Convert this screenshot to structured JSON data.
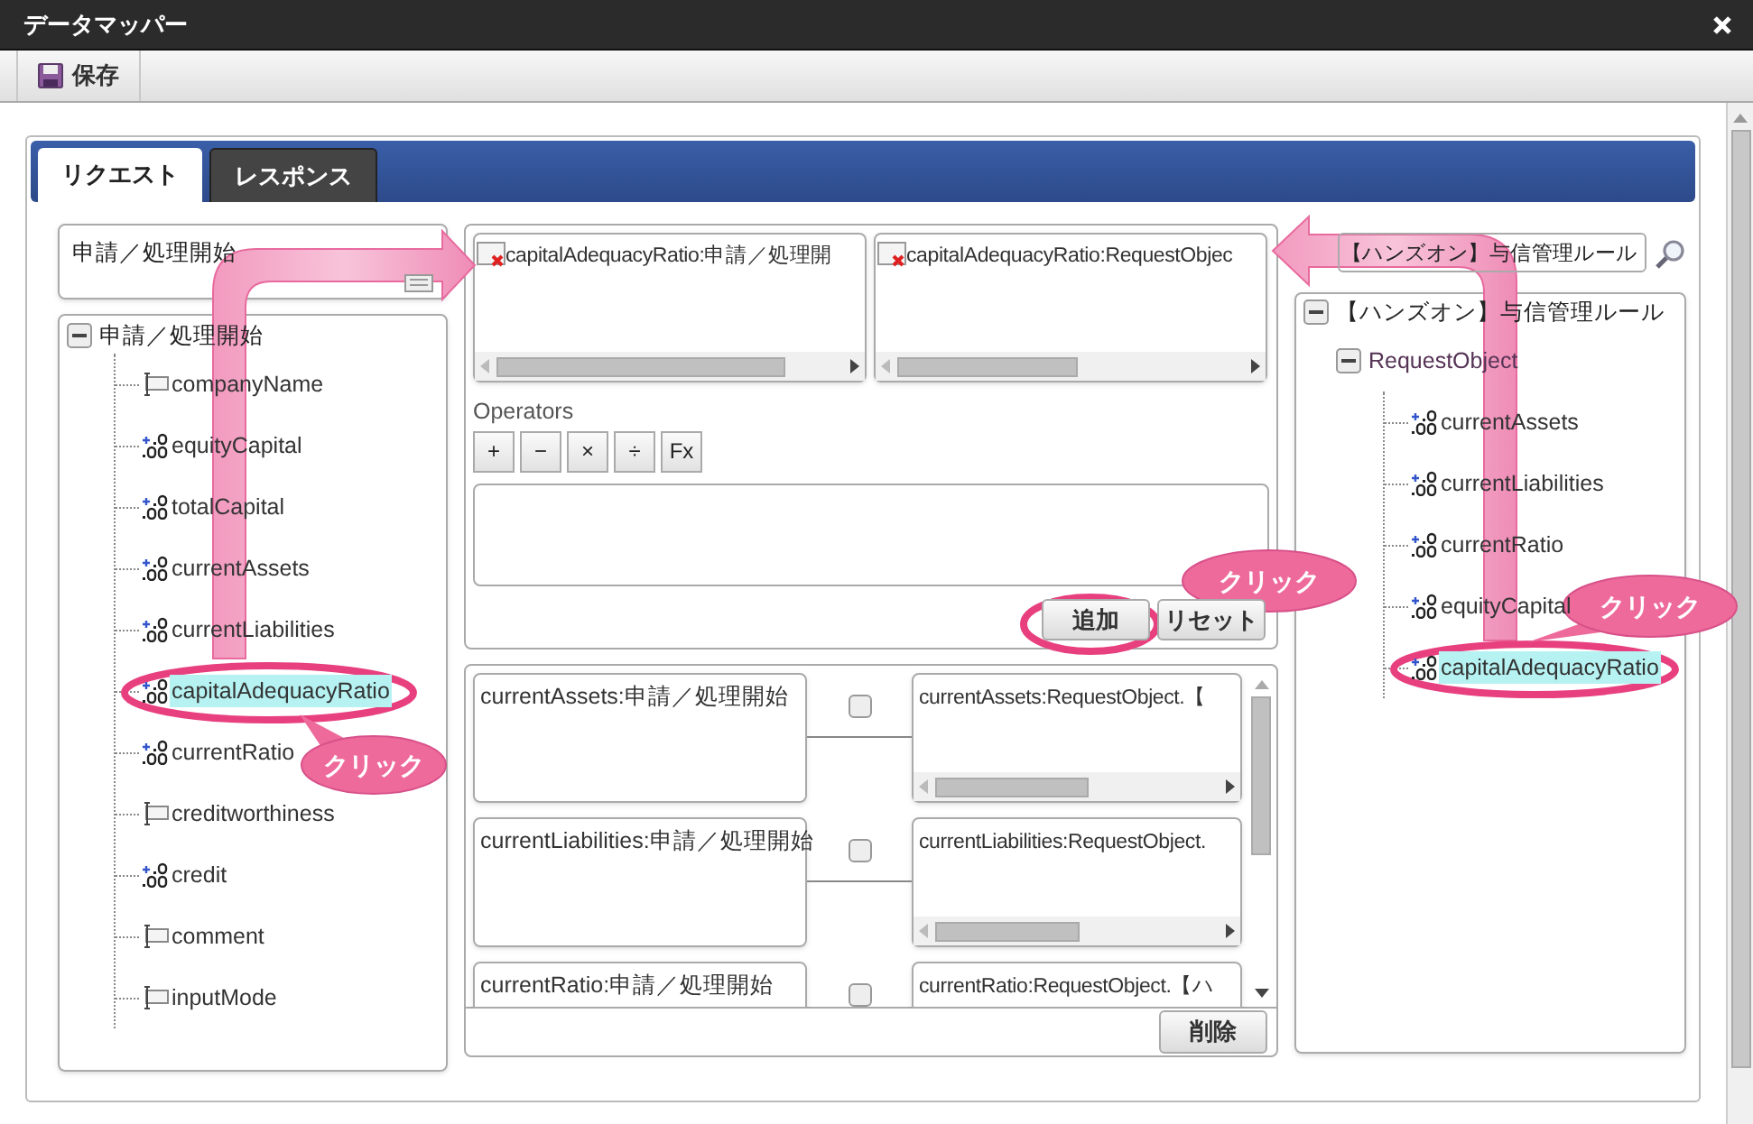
{
  "window": {
    "title": "データマッパー"
  },
  "toolbar": {
    "save_button": "保存"
  },
  "tabs": [
    {
      "label": "リクエスト",
      "selected": true
    },
    {
      "label": "レスポンス",
      "selected": false
    }
  ],
  "source": {
    "title": "申請／処理開始",
    "tree": {
      "label": "申請／処理開始",
      "expanded": true,
      "children": [
        {
          "label": "companyName",
          "kind": "text",
          "selected": false
        },
        {
          "label": "equityCapital",
          "kind": "number",
          "selected": false
        },
        {
          "label": "totalCapital",
          "kind": "number",
          "selected": false
        },
        {
          "label": "currentAssets",
          "kind": "number",
          "selected": false
        },
        {
          "label": "currentLiabilities",
          "kind": "number",
          "selected": false
        },
        {
          "label": "capitalAdequacyRatio",
          "kind": "number",
          "selected": true
        },
        {
          "label": "currentRatio",
          "kind": "number",
          "selected": false
        },
        {
          "label": "creditworthiness",
          "kind": "text",
          "selected": false
        },
        {
          "label": "credit",
          "kind": "number",
          "selected": false
        },
        {
          "label": "comment",
          "kind": "text",
          "selected": false
        },
        {
          "label": "inputMode",
          "kind": "text",
          "selected": false
        }
      ]
    }
  },
  "editor": {
    "source_field": "capitalAdequacyRatio:申請／処理開",
    "target_field": "capitalAdequacyRatio:RequestObjec",
    "operators_label": "Operators",
    "operators": [
      "+",
      "−",
      "×",
      "÷",
      "Fx"
    ],
    "add_button": "追加",
    "reset_button": "リセット"
  },
  "mappings": {
    "rows": [
      {
        "source": "currentAssets:申請／処理開始",
        "target": "currentAssets:RequestObject.【",
        "checked": false
      },
      {
        "source": "currentLiabilities:申請／処理開始",
        "target": "currentLiabilities:RequestObject.",
        "checked": false
      },
      {
        "source": "currentRatio:申請／処理開始",
        "target": "currentRatio:RequestObject.【ハ",
        "checked": false
      }
    ],
    "delete_button": "削除"
  },
  "target": {
    "search": {
      "value": "【ハンズオン】与信管理ルール"
    },
    "tree": {
      "label": "【ハンズオン】与信管理ルール",
      "expanded": true,
      "children": [
        {
          "label": "RequestObject",
          "expanded": true,
          "children": [
            {
              "label": "currentAssets",
              "kind": "number",
              "selected": false
            },
            {
              "label": "currentLiabilities",
              "kind": "number",
              "selected": false
            },
            {
              "label": "currentRatio",
              "kind": "number",
              "selected": false
            },
            {
              "label": "equityCapital",
              "kind": "number",
              "selected": false
            },
            {
              "label": "capitalAdequacyRatio",
              "kind": "number",
              "selected": true
            }
          ]
        }
      ]
    }
  },
  "annotations": {
    "callouts": [
      "クリック",
      "クリック",
      "クリック"
    ]
  }
}
